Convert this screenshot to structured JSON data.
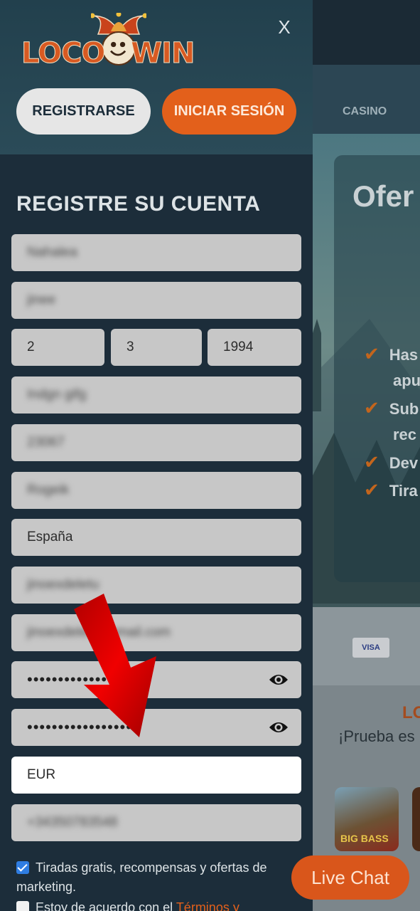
{
  "background": {
    "nav": {
      "casino_label": "CASINO"
    },
    "hero": {
      "title": "Ofer",
      "bullets": [
        "Has",
        "apu",
        "Sub",
        "rec",
        "Dev",
        "Tira"
      ]
    },
    "payment": {
      "card_label": "VISA"
    },
    "promo": {
      "title": "LO",
      "subtitle": "¡Prueba es",
      "game_label": "BIG BASS"
    }
  },
  "drawer": {
    "close_label": "X",
    "register_label": "REGISTRARSE",
    "login_label": "INICIAR SESIÓN",
    "form_title": "REGISTRE SU CUENTA",
    "fields": {
      "first_name": "Nahalea",
      "last_name": "jinee",
      "dob_day": "2",
      "dob_month": "3",
      "dob_year": "1994",
      "address": "Indgn gifg",
      "postal_code": "23067",
      "city": "Rogeik",
      "country": "España",
      "username": "jinoexdeletu",
      "email": "jinoexdelet          @gmail.com",
      "password": "•••••••••••••••••",
      "password_confirm": "•••••••••••••••••",
      "currency": "EUR",
      "phone": "+34350783548"
    },
    "checkboxes": {
      "marketing": {
        "label": "Tiradas gratis, recompensas y ofertas de marketing.",
        "checked": true
      },
      "terms": {
        "label": "Estoy de acuerdo con el ",
        "link": "Términos y",
        "checked": false
      }
    }
  },
  "live_chat_label": "Live Chat",
  "colors": {
    "accent": "#e3601b",
    "drawer_bg": "#1c2d3a",
    "arrow": "#e00000"
  }
}
